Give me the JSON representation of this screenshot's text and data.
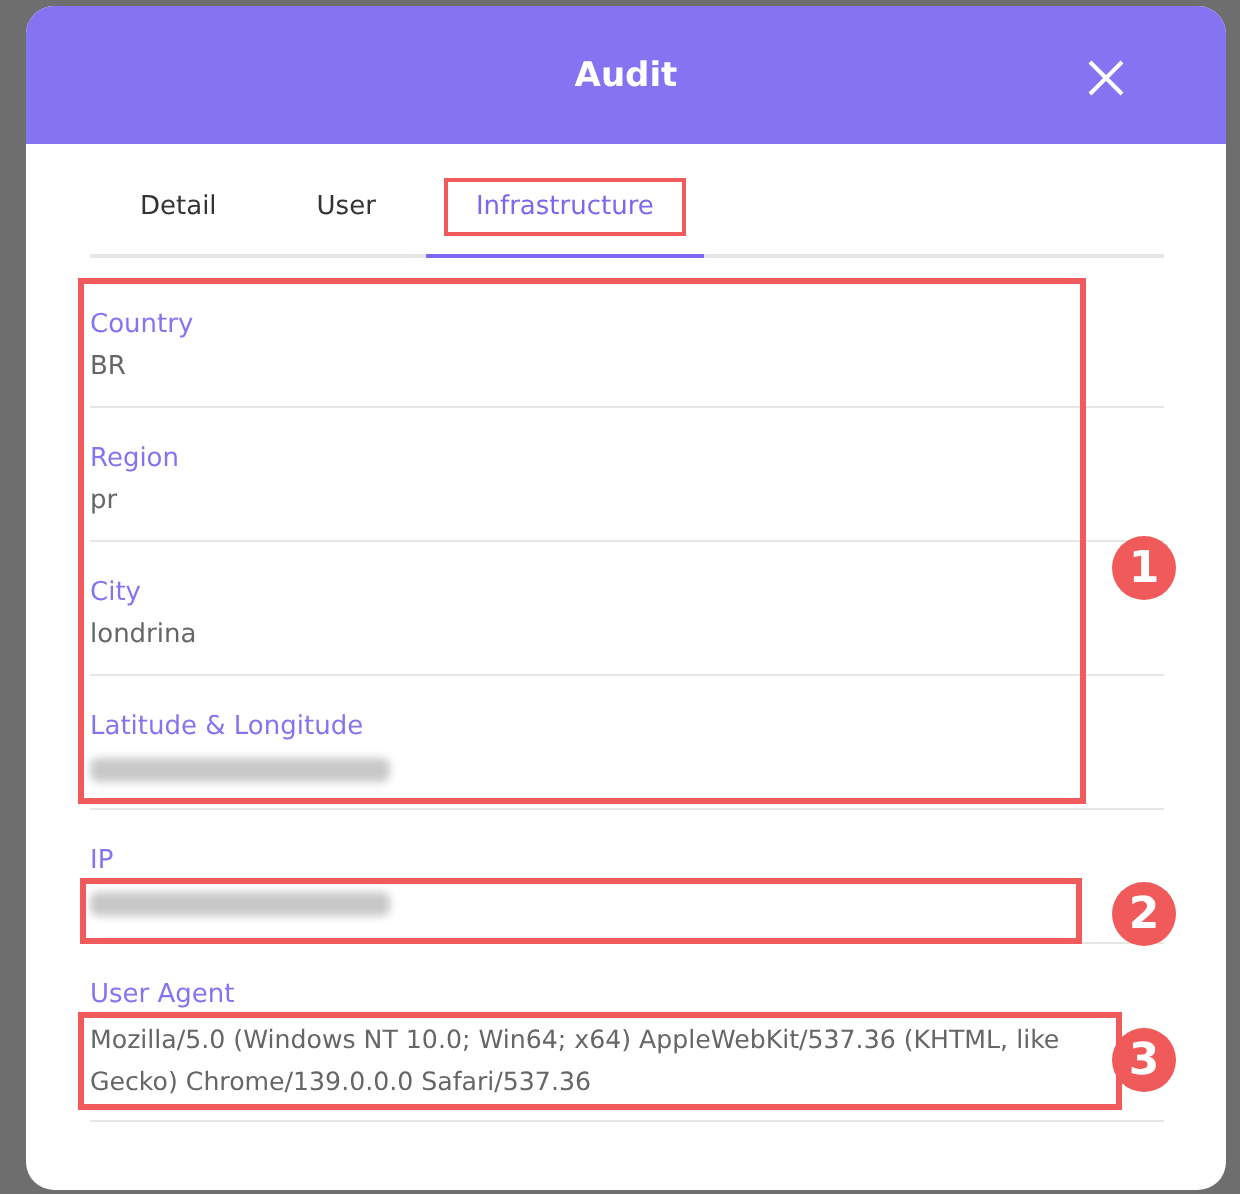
{
  "dialog": {
    "title": "Audit"
  },
  "tabs": [
    {
      "label": "Detail",
      "selected": false,
      "highlighted": false
    },
    {
      "label": "User",
      "selected": false,
      "highlighted": false
    },
    {
      "label": "Infrastructure",
      "selected": true,
      "highlighted": true
    }
  ],
  "fields": [
    {
      "label": "Country",
      "value": "BR",
      "redacted": false
    },
    {
      "label": "Region",
      "value": "pr",
      "redacted": false
    },
    {
      "label": "City",
      "value": "londrina",
      "redacted": false
    },
    {
      "label": "Latitude & Longitude",
      "redacted": true
    },
    {
      "label": "IP",
      "redacted": true
    },
    {
      "label": "User Agent",
      "value": "Mozilla/5.0 (Windows NT 10.0; Win64; x64) AppleWebKit/537.36 (KHTML, like Gecko) Chrome/139.0.0.0 Safari/537.36",
      "redacted": false
    }
  ],
  "annotations": [
    {
      "number": "1"
    },
    {
      "number": "2"
    },
    {
      "number": "3"
    }
  ]
}
